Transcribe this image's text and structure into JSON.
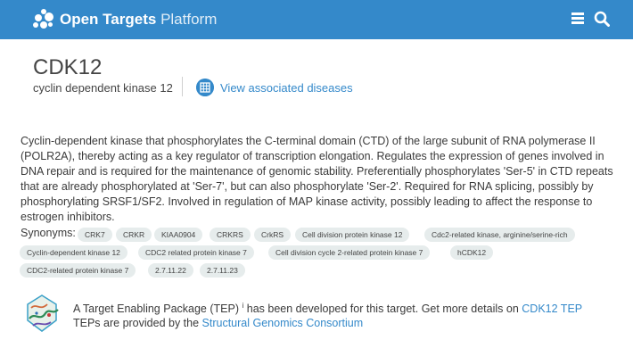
{
  "header": {
    "brand_bold": "Open Targets",
    "brand_light": "Platform",
    "bg_color": "#3489ca"
  },
  "target": {
    "symbol": "CDK12",
    "name": "cyclin dependent kinase 12",
    "assoc_link": "View associated diseases"
  },
  "description": "Cyclin-dependent kinase that phosphorylates the C-terminal domain (CTD) of the large subunit of RNA polymerase II (POLR2A), thereby acting as a key regulator of transcription elongation. Regulates the expression of genes involved in DNA repair and is required for the maintenance of genomic stability. Preferentially phosphorylates 'Ser-5' in CTD repeats that are already phosphorylated at 'Ser-7', but can also phosphorylate 'Ser-2'. Required for RNA splicing, possibly by phosphorylating SRSF1/SF2. Involved in regulation of MAP kinase activity, possibly leading to affect the response to estrogen inhibitors.",
  "synonyms": {
    "label": "Synonyms:",
    "items": [
      "CRK7",
      "CRKR",
      "KIAA0904",
      "CRKRS",
      "CrkRS",
      "Cell division protein kinase 12",
      "Cdc2-related kinase, arginine/serine-rich",
      "Cyclin-dependent kinase 12",
      "CDC2 related protein kinase 7",
      "Cell division cycle 2-related protein kinase 7",
      "hCDK12",
      "CDC2-related protein kinase 7",
      "2.7.11.22",
      "2.7.11.23"
    ]
  },
  "tep": {
    "line1_pre": "A Target Enabling Package (TEP)",
    "info_symbol": "i",
    "line1_post": " has been developed for this target. Get more details on ",
    "line1_link": "CDK12 TEP",
    "line2_pre": "TEPs are provided by the ",
    "line2_link": "Structural Genomics Consortium"
  },
  "colors": {
    "accent": "#3489ca",
    "pill_bg": "#e6ecec"
  },
  "icons": [
    "open-targets-logo",
    "menu-icon",
    "search-icon",
    "grid-icon",
    "info-icon",
    "tep-protein-icon"
  ]
}
